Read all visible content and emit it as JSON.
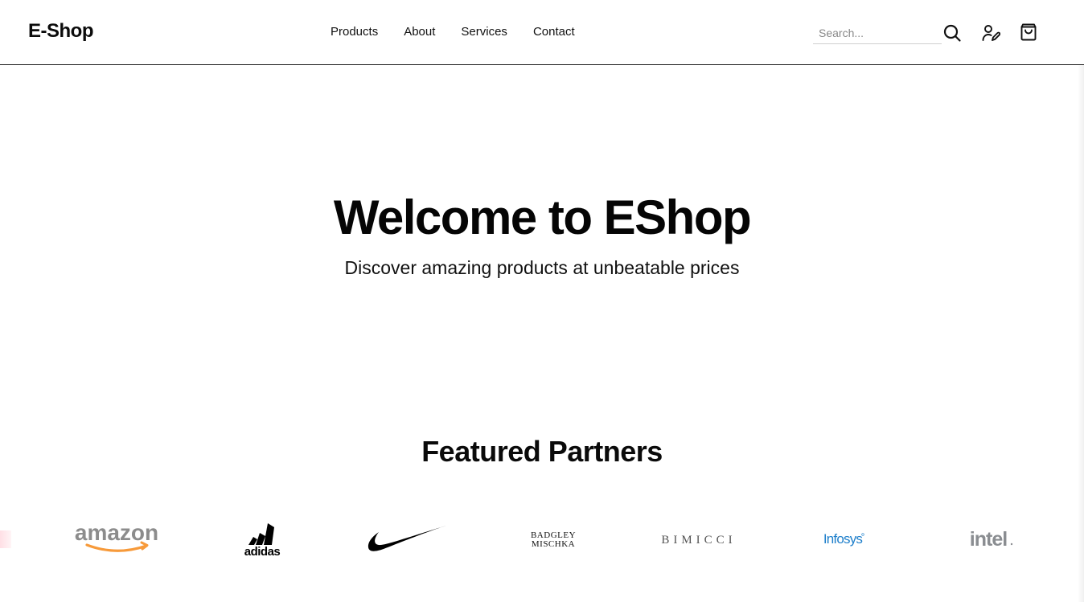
{
  "header": {
    "logo": "E-Shop",
    "nav": [
      "Products",
      "About",
      "Services",
      "Contact"
    ],
    "search_placeholder": "Search...",
    "icons": [
      "search-icon",
      "user-edit-icon",
      "shopping-bag-icon"
    ]
  },
  "hero": {
    "title": "Welcome to EShop",
    "subtitle": "Discover amazing products at unbeatable prices"
  },
  "partners": {
    "title": "Featured Partners",
    "logos": [
      {
        "name": "amazon",
        "text": "amazon"
      },
      {
        "name": "adidas",
        "text": "adidas"
      },
      {
        "name": "nike",
        "text": ""
      },
      {
        "name": "badgley-mischka",
        "text_line1": "BADGLEY",
        "text_line2": "MISCHKA"
      },
      {
        "name": "bimicci",
        "text": "BIMICCI"
      },
      {
        "name": "infosys",
        "text": "Infosys"
      },
      {
        "name": "intel",
        "text": "intel"
      }
    ]
  },
  "colors": {
    "text": "#0b0b0b",
    "amazon_arrow": "#f79a3a",
    "infosys_blue": "#1e7fcb",
    "intel_gray": "#8a8d91",
    "divider": "#1a1a1a"
  }
}
